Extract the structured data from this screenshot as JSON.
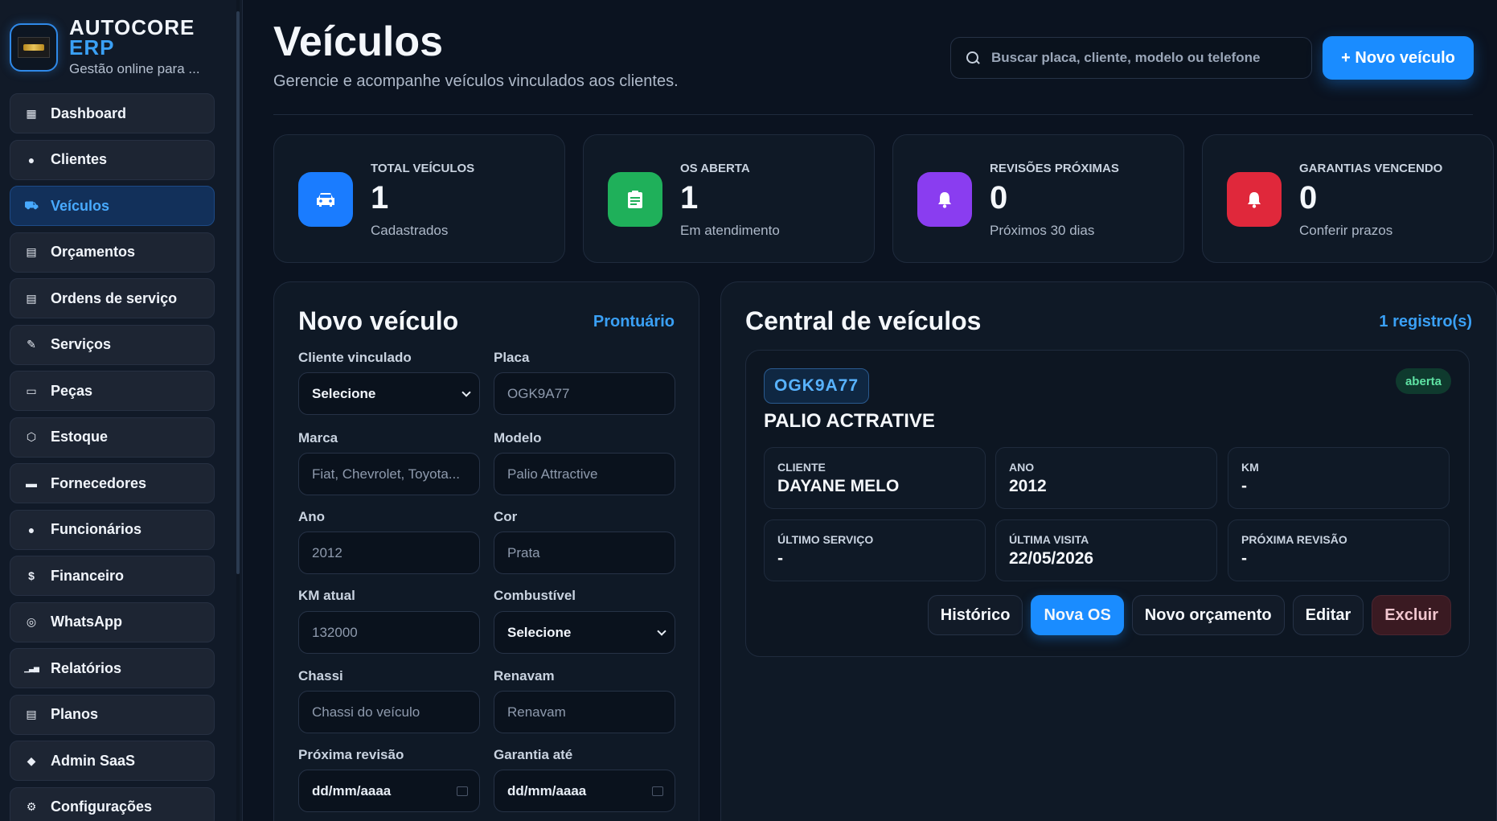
{
  "brand": {
    "line1": "AUTOCORE",
    "line2": "ERP",
    "tagline": "Gestão online para ..."
  },
  "sidebar": {
    "items": [
      {
        "label": "Dashboard",
        "icon": "dashboard-icon",
        "glyph": "▦",
        "active": false
      },
      {
        "label": "Clientes",
        "icon": "user-icon",
        "glyph": "●",
        "active": false
      },
      {
        "label": "Veículos",
        "icon": "car-icon",
        "glyph": "⛟",
        "active": true
      },
      {
        "label": "Orçamentos",
        "icon": "document-icon",
        "glyph": "▤",
        "active": false
      },
      {
        "label": "Ordens de serviço",
        "icon": "clipboard-icon",
        "glyph": "▤",
        "active": false
      },
      {
        "label": "Serviços",
        "icon": "wrench-icon",
        "glyph": "✎",
        "active": false
      },
      {
        "label": "Peças",
        "icon": "part-icon",
        "glyph": "▭",
        "active": false
      },
      {
        "label": "Estoque",
        "icon": "box-icon",
        "glyph": "⬡",
        "active": false
      },
      {
        "label": "Fornecedores",
        "icon": "truck-icon",
        "glyph": "▬",
        "active": false
      },
      {
        "label": "Funcionários",
        "icon": "employee-icon",
        "glyph": "●",
        "active": false
      },
      {
        "label": "Financeiro",
        "icon": "dollar-icon",
        "glyph": "$",
        "active": false
      },
      {
        "label": "WhatsApp",
        "icon": "whatsapp-icon",
        "glyph": "◎",
        "active": false
      },
      {
        "label": "Relatórios",
        "icon": "bar-chart-icon",
        "glyph": "▁▃▅",
        "active": false
      },
      {
        "label": "Planos",
        "icon": "card-icon",
        "glyph": "▤",
        "active": false
      },
      {
        "label": "Admin SaaS",
        "icon": "shield-icon",
        "glyph": "◆",
        "active": false
      },
      {
        "label": "Configurações",
        "icon": "gear-icon",
        "glyph": "⚙",
        "active": false
      }
    ]
  },
  "header": {
    "title": "Veículos",
    "subtitle": "Gerencie e acompanhe veículos vinculados aos clientes.",
    "search_placeholder": "Buscar placa, cliente, modelo ou telefone",
    "new_button": "+ Novo veículo"
  },
  "stats": [
    {
      "label": "TOTAL VEÍCULOS",
      "value": "1",
      "desc": "Cadastrados",
      "icon": "car-icon",
      "color": "#1a7cff"
    },
    {
      "label": "OS ABERTA",
      "value": "1",
      "desc": "Em atendimento",
      "icon": "clipboard-icon",
      "color": "#1fb05a"
    },
    {
      "label": "REVISÕES PRÓXIMAS",
      "value": "0",
      "desc": "Próximos 30 dias",
      "icon": "bell-icon",
      "color": "#8a3df0"
    },
    {
      "label": "GARANTIAS VENCENDO",
      "value": "0",
      "desc": "Conferir prazos",
      "icon": "alert-bell-icon",
      "color": "#e0283b"
    }
  ],
  "form": {
    "title": "Novo veículo",
    "link": "Prontuário",
    "cliente_label": "Cliente vinculado",
    "cliente_value": "Selecione",
    "placa_label": "Placa",
    "placa_placeholder": "OGK9A77",
    "marca_label": "Marca",
    "marca_placeholder": "Fiat, Chevrolet, Toyota...",
    "modelo_label": "Modelo",
    "modelo_placeholder": "Palio Attractive",
    "ano_label": "Ano",
    "ano_placeholder": "2012",
    "cor_label": "Cor",
    "cor_placeholder": "Prata",
    "km_label": "KM atual",
    "km_placeholder": "132000",
    "combustivel_label": "Combustível",
    "combustivel_value": "Selecione",
    "chassi_label": "Chassi",
    "chassi_placeholder": "Chassi do veículo",
    "renavam_label": "Renavam",
    "renavam_placeholder": "Renavam",
    "revisao_label": "Próxima revisão",
    "revisao_value": "dd/mm/aaaa",
    "garantia_label": "Garantia até",
    "garantia_value": "dd/mm/aaaa"
  },
  "central": {
    "title": "Central de veículos",
    "count": "1 registro(s)",
    "vehicle": {
      "plate": "OGK9A77",
      "status": "aberta",
      "name": "PALIO ACTRATIVE",
      "info": [
        {
          "label": "CLIENTE",
          "value": "DAYANE MELO"
        },
        {
          "label": "ANO",
          "value": "2012"
        },
        {
          "label": "KM",
          "value": "-"
        },
        {
          "label": "ÚLTIMO SERVIÇO",
          "value": "-"
        },
        {
          "label": "ÚLTIMA VISITA",
          "value": "22/05/2026"
        },
        {
          "label": "PRÓXIMA REVISÃO",
          "value": "-"
        }
      ],
      "actions": {
        "history": "Histórico",
        "new_os": "Nova OS",
        "new_quote": "Novo orçamento",
        "edit": "Editar",
        "delete": "Excluir"
      }
    }
  }
}
